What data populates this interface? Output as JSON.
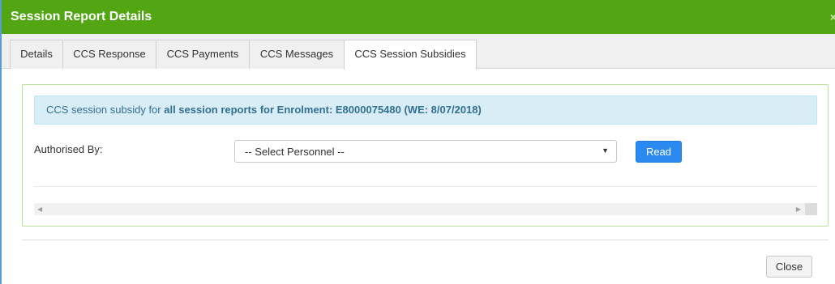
{
  "dialog": {
    "title": "Session Report Details",
    "close_glyph": "×"
  },
  "tabs": [
    {
      "label": "Details",
      "active": false
    },
    {
      "label": "CCS Response",
      "active": false
    },
    {
      "label": "CCS Payments",
      "active": false
    },
    {
      "label": "CCS Messages",
      "active": false
    },
    {
      "label": "CCS Session Subsidies",
      "active": true
    }
  ],
  "info": {
    "prefix": "CCS session subsidy for ",
    "bold": "all session reports for Enrolment: E8000075480 (WE: 8/07/2018)"
  },
  "form": {
    "authorised_by_label": "Authorised By:",
    "personnel_select_value": "-- Select Personnel --",
    "read_button": "Read"
  },
  "footer": {
    "close_button": "Close"
  },
  "colors": {
    "titlebar": "#52a614",
    "info_bg": "#d9edf7",
    "info_text": "#31708f",
    "primary_button": "#2b8af0",
    "panel_border": "#b9e39c"
  },
  "icons": {
    "dialog_close": "close-icon",
    "select_caret": "caret-down-icon",
    "scroll_left": "arrow-left-icon",
    "scroll_right": "arrow-right-icon"
  }
}
